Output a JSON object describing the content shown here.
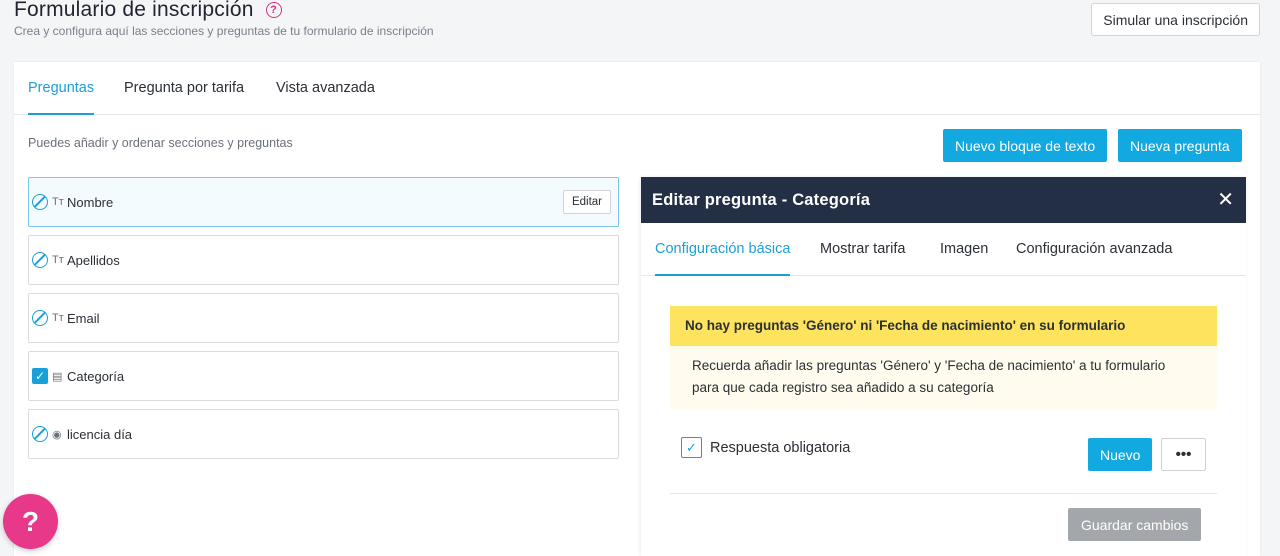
{
  "header": {
    "title": "Formulario de inscripción",
    "help_icon": "?",
    "subtitle": "Crea y configura aquí las secciones y preguntas de tu formulario de inscripción",
    "simulate_label": "Simular una inscripción"
  },
  "tabs": [
    {
      "label": "Preguntas",
      "active": true
    },
    {
      "label": "Pregunta por tarifa",
      "active": false
    },
    {
      "label": "Vista avanzada",
      "active": false
    }
  ],
  "toolbar": {
    "hint": "Puedes añadir y ordenar secciones y preguntas",
    "new_text_block_label": "Nuevo bloque de texto",
    "new_question_label": "Nueva pregunta"
  },
  "questions": [
    {
      "label": "Nombre",
      "status_icon": "ban-icon",
      "type_icon": "text-type-icon",
      "type_glyph": "Tт",
      "edit_label": "Editar"
    },
    {
      "label": "Apellidos",
      "status_icon": "ban-icon",
      "type_icon": "text-type-icon",
      "type_glyph": "Tт"
    },
    {
      "label": "Email",
      "status_icon": "ban-icon",
      "type_icon": "text-type-icon",
      "type_glyph": "Tт"
    },
    {
      "label": "Categoría",
      "status_icon": "checkbox-checked-icon",
      "type_icon": "list-type-icon",
      "type_glyph": "▤"
    },
    {
      "label": "licencia día",
      "status_icon": "ban-icon",
      "type_icon": "radio-type-icon",
      "type_glyph": "◉"
    }
  ],
  "panel": {
    "title": "Editar pregunta - Categoría",
    "close_glyph": "✕",
    "tabs": [
      {
        "label": "Configuración básica",
        "active": true
      },
      {
        "label": "Mostrar tarifa",
        "active": false
      },
      {
        "label": "Imagen",
        "active": false
      },
      {
        "label": "Configuración avanzada",
        "active": false
      }
    ],
    "warning_title": "No hay preguntas 'Género' ni 'Fecha de nacimiento' en su formulario",
    "warning_body": "Recuerda añadir las preguntas 'Género' y 'Fecha de nacimiento' a tu formulario para que cada registro sea añadido a su categoría",
    "required_label": "Respuesta obligatoria",
    "required_checked": true,
    "nuevo_label": "Nuevo",
    "more_glyph": "•••",
    "save_label": "Guardar cambios"
  },
  "help_fab": "?",
  "colors": {
    "accent": "#12a8e0",
    "header_dark": "#232f45",
    "warning": "#fde35e",
    "fab": "#e8388a",
    "help": "#d6317f",
    "disabled": "#a3a6aa"
  }
}
